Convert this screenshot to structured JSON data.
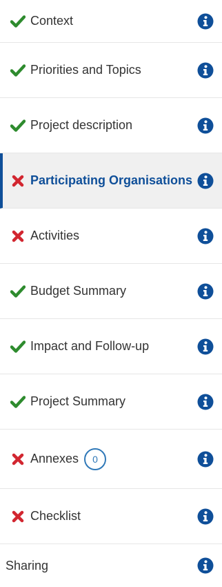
{
  "colors": {
    "accent": "#0f4f99",
    "check": "#2e8b2e",
    "cross": "#d22630",
    "info": "#0f4f99",
    "badge": "#2f78b8"
  },
  "nav": {
    "items": [
      {
        "label": "Context",
        "status": "check-icon"
      },
      {
        "label": "Priorities and Topics",
        "status": "check-icon"
      },
      {
        "label": "Project description",
        "status": "check-icon"
      },
      {
        "label": "Participating Organisations",
        "status": "cross-icon",
        "active": true
      },
      {
        "label": "Activities",
        "status": "cross-icon"
      },
      {
        "label": "Budget Summary",
        "status": "check-icon"
      },
      {
        "label": "Impact and Follow-up",
        "status": "check-icon"
      },
      {
        "label": "Project Summary",
        "status": "check-icon"
      },
      {
        "label": "Annexes",
        "status": "cross-icon",
        "badge": "0"
      },
      {
        "label": "Checklist",
        "status": "cross-icon"
      },
      {
        "label": "Sharing"
      }
    ]
  }
}
